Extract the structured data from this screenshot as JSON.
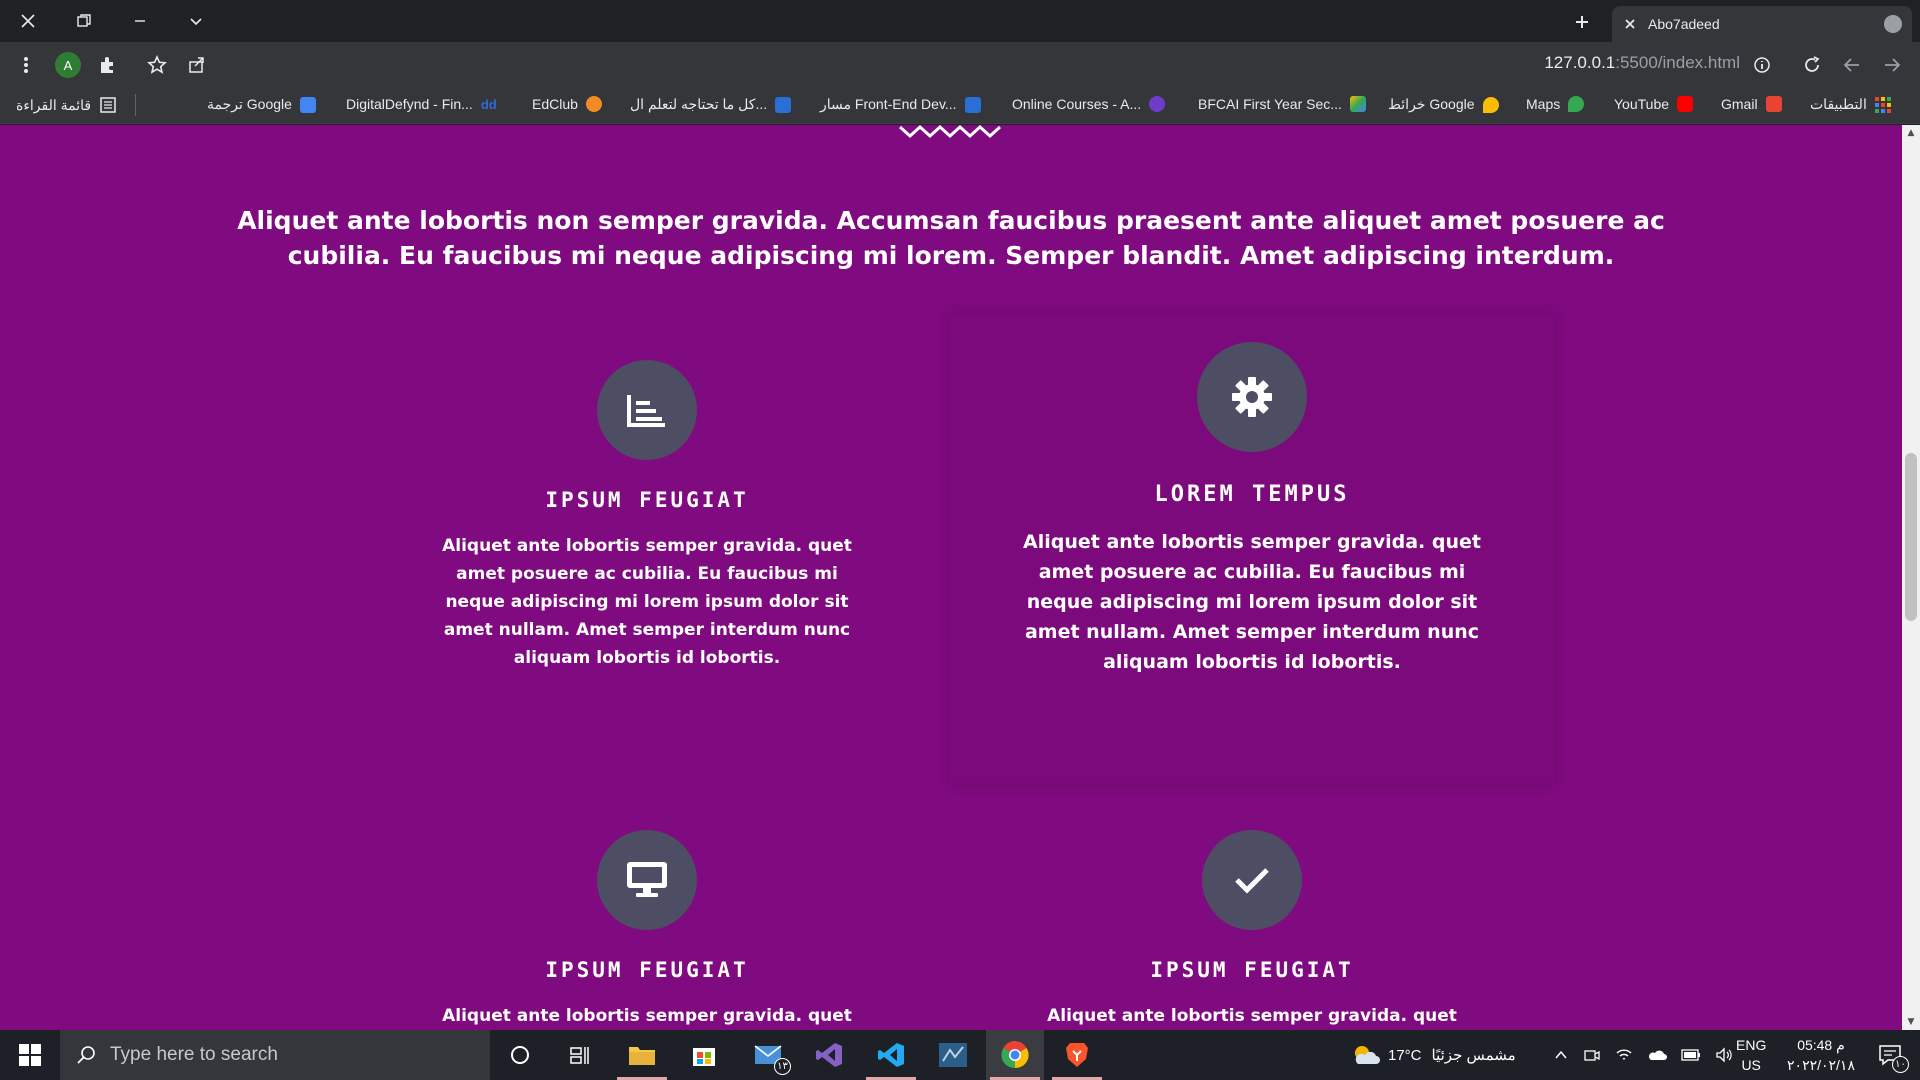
{
  "browser": {
    "tab_title": "Abo7adeed",
    "url_host": "127.0.0.1",
    "url_path": ":5500/index.html",
    "profile_initial": "A"
  },
  "bookmarks": {
    "apps": "التطبيقات",
    "items": [
      {
        "label": "Gmail",
        "icon_color": "#ea4335"
      },
      {
        "label": "YouTube",
        "icon_color": "#ff0000"
      },
      {
        "label": "Maps",
        "icon_color": "#34a853"
      },
      {
        "label": "خرائط Google",
        "icon_color": "#fbbc04"
      },
      {
        "label": "BFCAI First Year Sec...",
        "icon_color": "#1a73e8"
      },
      {
        "label": "Online Courses - A...",
        "icon_color": "#6f3cc9"
      },
      {
        "label": "مسار Front-End Dev...",
        "icon_color": "#2a6fd6"
      },
      {
        "label": "كل ما تحتاجه لتعلم ال...",
        "icon_color": "#2a6fd6"
      },
      {
        "label": "EdClub",
        "icon_color": "#f28b25"
      },
      {
        "label": "DigitalDefynd - Fin...",
        "icon_color": "#2f6bd8"
      },
      {
        "label": "ترجمة Google",
        "icon_color": "#4285f4"
      }
    ],
    "reading_list": "قائمة القراءة"
  },
  "page": {
    "intro": "Aliquet ante lobortis non semper gravida. Accumsan faucibus praesent ante aliquet amet posuere ac cubilia. Eu faucibus mi neque adipiscing mi lorem. Semper blandit. Amet adipiscing interdum.",
    "features": [
      {
        "icon": "chart-icon",
        "title": "IPSUM FEUGIAT",
        "text": "Aliquet ante lobortis semper gravida. quet amet posuere ac cubilia. Eu faucibus mi neque adipiscing mi lorem ipsum dolor sit amet nullam. Amet semper interdum nunc aliquam lobortis id lobortis."
      },
      {
        "icon": "gear-icon",
        "title": "LOREM TEMPUS",
        "text": "Aliquet ante lobortis semper gravida. quet amet posuere ac cubilia. Eu faucibus mi neque adipiscing mi lorem ipsum dolor sit amet nullam. Amet semper interdum nunc aliquam lobortis id lobortis."
      },
      {
        "icon": "desktop-icon",
        "title": "IPSUM FEUGIAT",
        "text": "Aliquet ante lobortis semper gravida. quet"
      },
      {
        "icon": "check-icon",
        "title": "IPSUM FEUGIAT",
        "text": "Aliquet ante lobortis semper gravida. quet"
      }
    ],
    "background_color": "#800a80",
    "icon_circle_color": "#4d4d63"
  },
  "taskbar": {
    "search_placeholder": "Type here to search",
    "weather_temp": "17°C",
    "weather_text": "مشمس جزئيًا",
    "lang_top": "ENG",
    "lang_bottom": "US",
    "time": "05:48 م",
    "date": "٢٠٢٢/٠٢/١٨",
    "mail_badge": "١٣",
    "notification_badge": "١٠"
  }
}
